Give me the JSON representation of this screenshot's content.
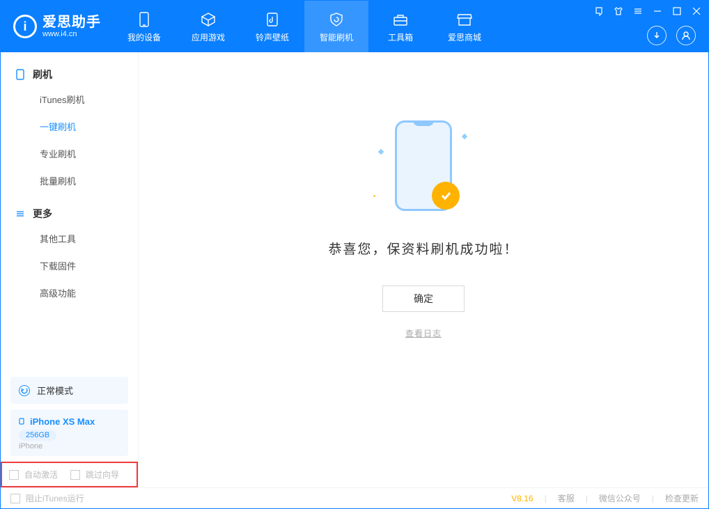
{
  "app": {
    "name": "爱思助手",
    "url": "www.i4.cn"
  },
  "nav": {
    "items": [
      {
        "label": "我的设备"
      },
      {
        "label": "应用游戏"
      },
      {
        "label": "铃声壁纸"
      },
      {
        "label": "智能刷机"
      },
      {
        "label": "工具箱"
      },
      {
        "label": "爱思商城"
      }
    ],
    "active_index": 3
  },
  "sidebar": {
    "groups": [
      {
        "title": "刷机",
        "items": [
          "iTunes刷机",
          "一键刷机",
          "专业刷机",
          "批量刷机"
        ],
        "active_index": 1
      },
      {
        "title": "更多",
        "items": [
          "其他工具",
          "下载固件",
          "高级功能"
        ]
      }
    ],
    "mode_card": {
      "label": "正常模式"
    },
    "device_card": {
      "name": "iPhone XS Max",
      "storage": "256GB",
      "type": "iPhone"
    },
    "checkbox1": "自动激活",
    "checkbox2": "跳过向导"
  },
  "main": {
    "success_msg": "恭喜您，保资料刷机成功啦！",
    "ok_label": "确定",
    "log_label": "查看日志"
  },
  "footer": {
    "block_itunes": "阻止iTunes运行",
    "version": "V8.16",
    "links": [
      "客服",
      "微信公众号",
      "检查更新"
    ]
  }
}
